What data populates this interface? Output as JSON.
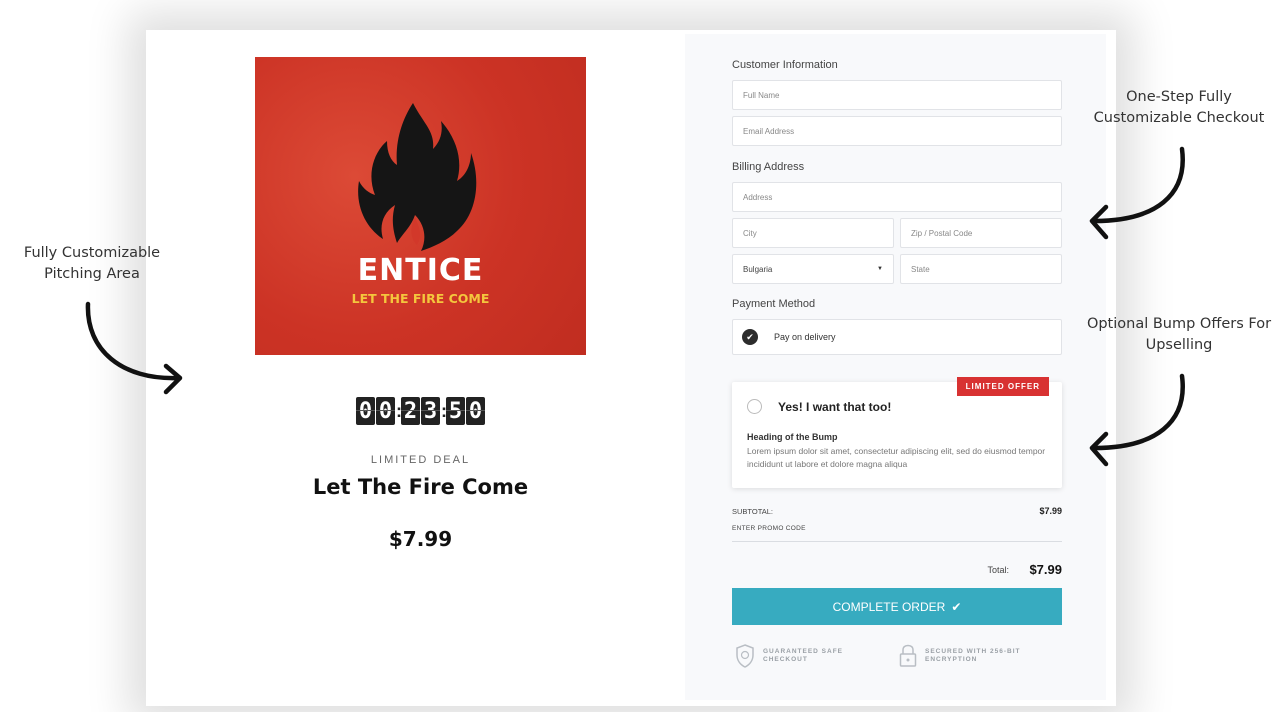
{
  "product": {
    "cover_title": "ENTICE",
    "cover_subtitle": "LET THE FIRE COME",
    "timer_digits": [
      "0",
      "0",
      "2",
      "3",
      "5",
      "0"
    ],
    "deal_label": "LIMITED DEAL",
    "title": "Let The Fire Come",
    "price": "$7.99"
  },
  "checkout": {
    "customer_heading": "Customer Information",
    "full_name_placeholder": "Full Name",
    "email_placeholder": "Email Address",
    "billing_heading": "Billing Address",
    "address_placeholder": "Address",
    "city_placeholder": "City",
    "zip_placeholder": "Zip / Postal Code",
    "country_value": "Bulgaria",
    "state_placeholder": "State",
    "payment_heading": "Payment Method",
    "payment_option": "Pay on delivery"
  },
  "bump": {
    "badge": "LIMITED OFFER",
    "title": "Yes! I want that too!",
    "heading": "Heading of the Bump",
    "body": "Lorem ipsum dolor sit amet, consectetur adipiscing elit, sed do eiusmod tempor incididunt ut labore et dolore magna aliqua"
  },
  "summary": {
    "subtotal_label": "SUBTOTAL:",
    "subtotal_value": "$7.99",
    "promo_label": "ENTER PROMO CODE",
    "total_label": "Total:",
    "total_value": "$7.99",
    "button_label": "COMPLETE ORDER",
    "trust_safe": "GUARANTEED SAFE CHECKOUT",
    "trust_secure": "SECURED WITH 256-BIT ENCRYPTION"
  },
  "annotations": {
    "left": "Fully Customizable Pitching Area",
    "top_right": "One-Step Fully Customizable Checkout",
    "mid_right": "Optional Bump Offers For Upselling"
  },
  "colors": {
    "accent": "#37abc0",
    "cover_red": "#d2382a",
    "cover_yellow": "#f4c63d",
    "badge_red": "#d83232"
  }
}
